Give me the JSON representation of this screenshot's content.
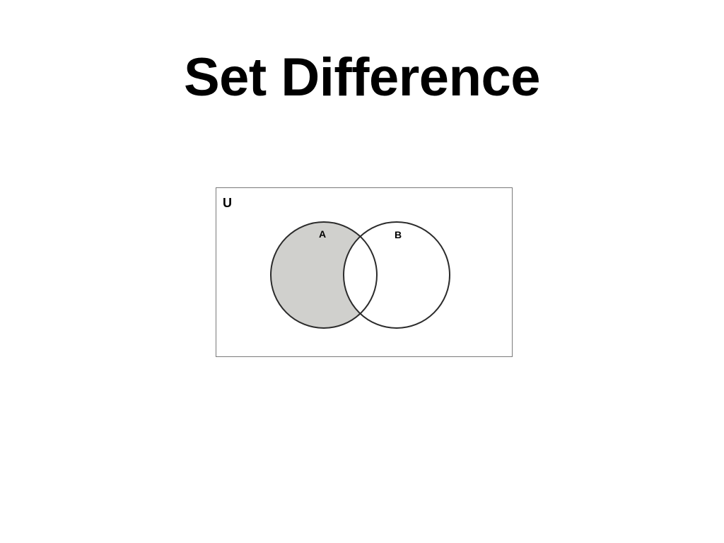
{
  "slide": {
    "title": "Set Difference"
  },
  "diagram": {
    "universe_label": "U",
    "set_a_label": "A",
    "set_b_label": "B",
    "shaded_region": "A minus B",
    "colors": {
      "shade": "#d0d0cd",
      "outline": "#2b2b2b",
      "frame": "#7a7a7a",
      "background": "#ffffff"
    }
  }
}
